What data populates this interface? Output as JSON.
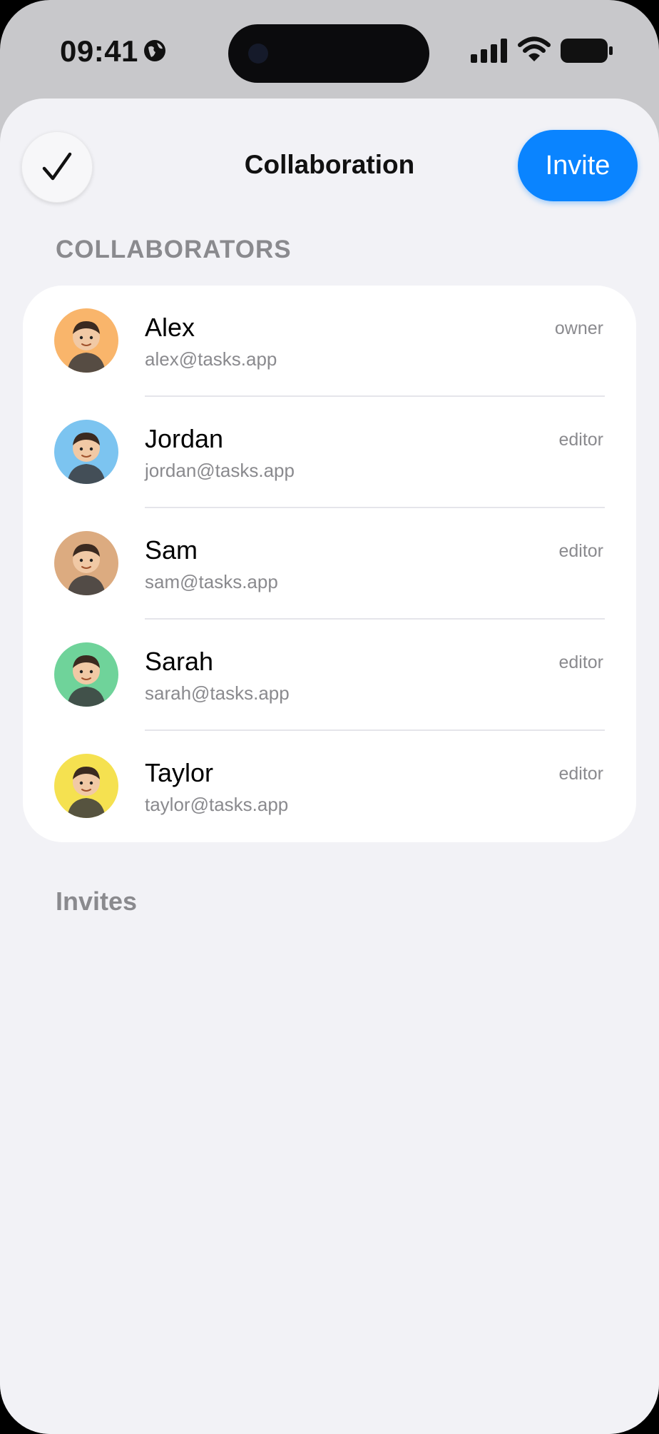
{
  "status_bar": {
    "time": "09:41"
  },
  "header": {
    "title": "Collaboration",
    "invite_label": "Invite"
  },
  "collaborators_section": {
    "header": "COLLABORATORS"
  },
  "collaborators": [
    {
      "name": "Alex",
      "email": "alex@tasks.app",
      "role": "owner",
      "avatar_bg": "#f9b56b",
      "avatar_icon": "memoji-avatar"
    },
    {
      "name": "Jordan",
      "email": "jordan@tasks.app",
      "role": "editor",
      "avatar_bg": "#7cc4f0",
      "avatar_icon": "memoji-avatar"
    },
    {
      "name": "Sam",
      "email": "sam@tasks.app",
      "role": "editor",
      "avatar_bg": "#dcab80",
      "avatar_icon": "memoji-avatar"
    },
    {
      "name": "Sarah",
      "email": "sarah@tasks.app",
      "role": "editor",
      "avatar_bg": "#6fd39a",
      "avatar_icon": "memoji-avatar"
    },
    {
      "name": "Taylor",
      "email": "taylor@tasks.app",
      "role": "editor",
      "avatar_bg": "#f5e150",
      "avatar_icon": "memoji-avatar"
    }
  ],
  "invites_section": {
    "header": "Invites"
  },
  "colors": {
    "accent": "#0a84ff",
    "background": "#f2f2f6",
    "secondary_text": "#8a8a8e"
  }
}
